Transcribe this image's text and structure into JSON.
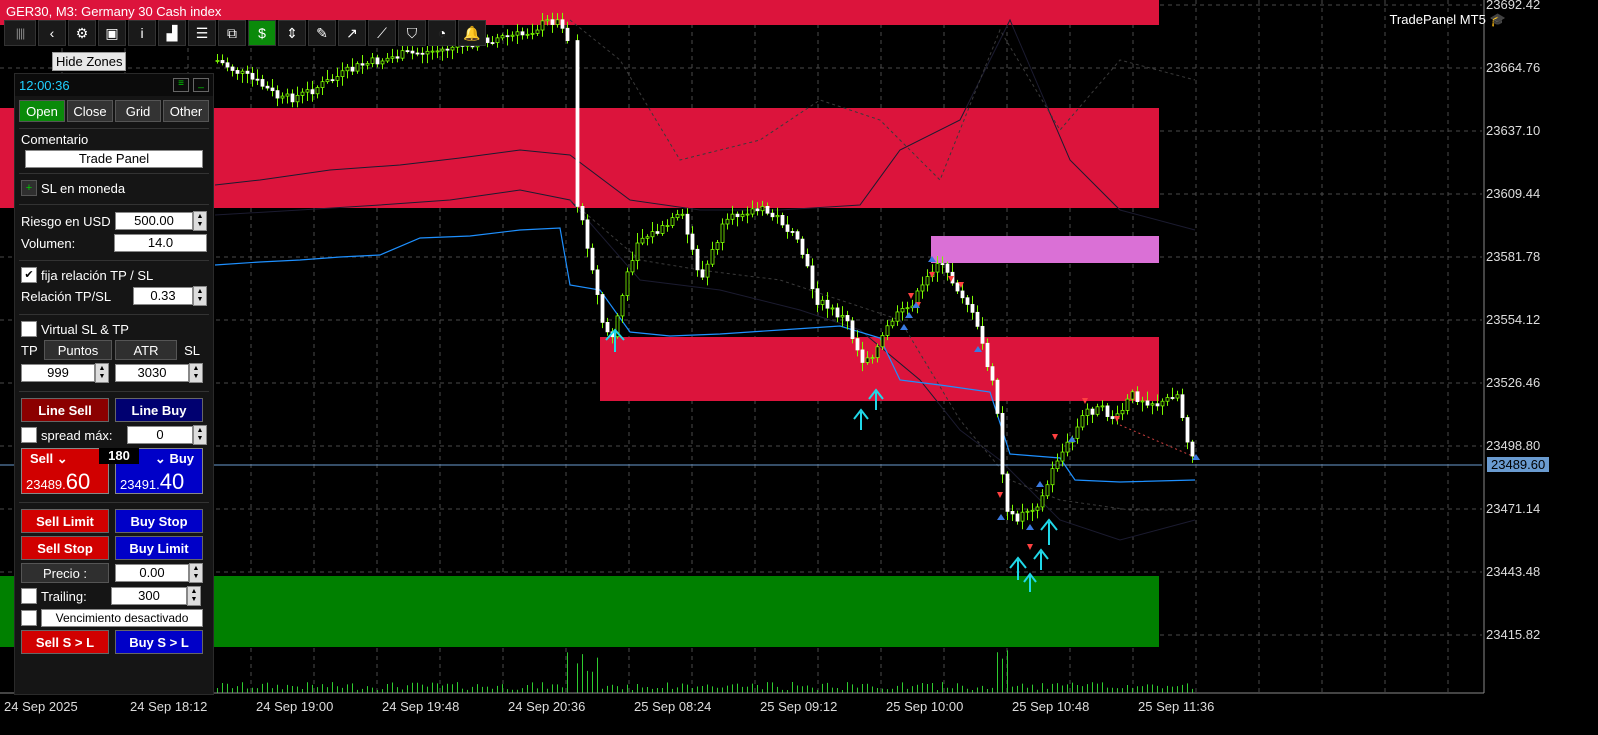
{
  "window": {
    "title": "GER30, M3:  Germany 30 Cash index",
    "brand": "TradePanel MT5"
  },
  "toolbar": {
    "icons": [
      "grip-icon",
      "back-icon",
      "gear-icon",
      "camera-icon",
      "info-icon",
      "bar-chart-icon",
      "list-icon",
      "sliders-icon",
      "dollar-icon",
      "ruler-icon",
      "pencil-icon",
      "trend-up-icon",
      "trend-zigzag-icon",
      "shield-icon",
      "pie-icon",
      "bell-icon"
    ],
    "hide_zones_label": "Hide Zones"
  },
  "panel": {
    "clock": "12:00:36",
    "tabs": [
      "Open",
      "Close",
      "Grid",
      "Other"
    ],
    "comment_label": "Comentario",
    "comment_value": "Trade Panel",
    "sl_currency_label": "SL en moneda",
    "risk_label": "Riesgo en USD",
    "risk_value": "500.00",
    "volume_label": "Volumen:",
    "volume_value": "14.0",
    "fixed_ratio_label": "fija relación TP / SL",
    "ratio_label": "Relación TP/SL",
    "ratio_value": "0.33",
    "virtual_label": "Virtual SL & TP",
    "tp_label": "TP",
    "sl_label": "SL",
    "points_label": "Puntos",
    "atr_label": "ATR",
    "tp_value": "999",
    "sl_value": "3030",
    "line_sell": "Line Sell",
    "line_buy": "Line Buy",
    "spread_label": "spread máx:",
    "spread_value": "0",
    "sell_label": "Sell",
    "buy_label": "Buy",
    "spread_points": "180",
    "sell_price_small": "23489.",
    "sell_price_big": "60",
    "buy_price_small": "23491.",
    "buy_price_big": "40",
    "sell_limit": "Sell Limit",
    "buy_stop": "Buy Stop",
    "sell_stop": "Sell Stop",
    "buy_limit": "Buy Limit",
    "price_label": "Precio :",
    "price_value": "0.00",
    "trailing_label": "Trailing:",
    "trailing_value": "300",
    "expiry_label": "Vencimiento desactivado",
    "sell_sl": "Sell S > L",
    "buy_sl": "Buy S > L"
  },
  "price_axis": [
    "23692.42",
    "23664.76",
    "23637.10",
    "23609.44",
    "23581.78",
    "23554.12",
    "23526.46",
    "23498.80",
    "23471.14",
    "23443.48",
    "23415.82"
  ],
  "current_price": "23489.60",
  "time_axis": [
    "24 Sep 2025",
    "24 Sep 18:12",
    "24 Sep 19:00",
    "24 Sep 19:48",
    "24 Sep 20:36",
    "25 Sep 08:24",
    "25 Sep 09:12",
    "25 Sep 10:00",
    "25 Sep 10:48",
    "25 Sep 11:36"
  ],
  "colors": {
    "zone_red": "#dc143c",
    "zone_green": "#008000",
    "zone_pink": "#da70d6",
    "bull": "#7cfc00",
    "bear": "#ffffff",
    "ma_line": "#1e90ff",
    "grid": "#555555"
  }
}
